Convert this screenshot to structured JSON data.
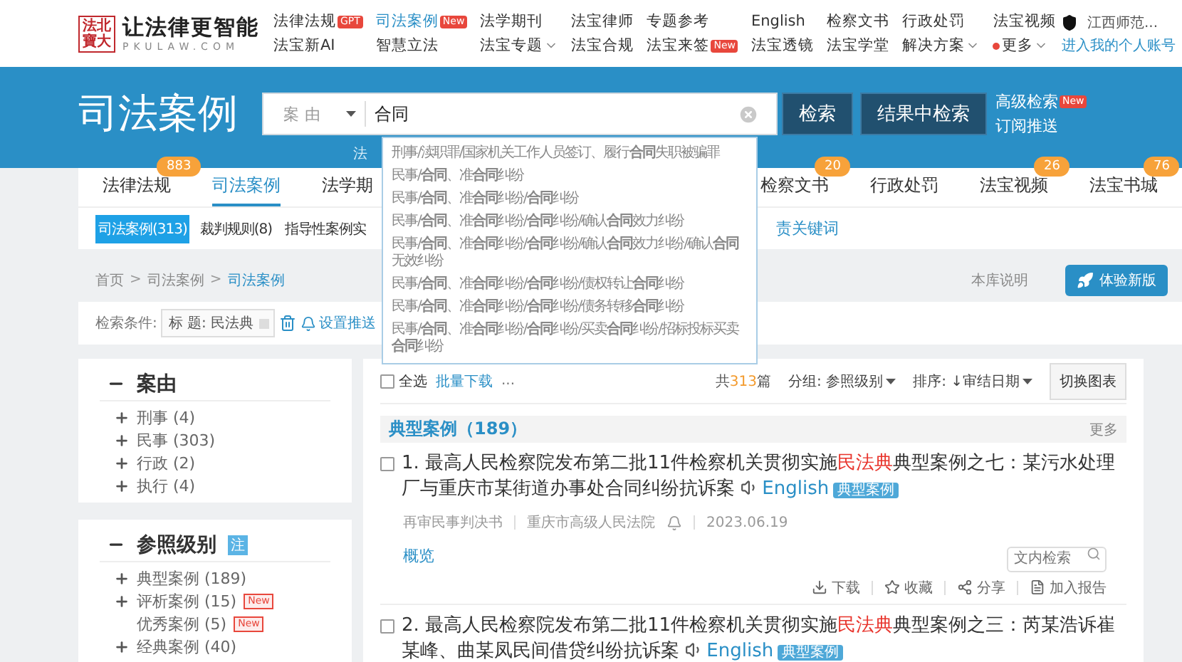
{
  "header": {
    "logo": {
      "seal": "法北寶大",
      "slogan": "让法律更智能",
      "domain": "PKULAW.COM"
    },
    "nav": [
      {
        "label": "法律法规",
        "selected": false,
        "badge": "GPT",
        "has_menu": false
      },
      {
        "label": "法宝新AI",
        "selected": false,
        "has_menu": false
      },
      {
        "label": "司法案例",
        "selected": true,
        "badge": "New",
        "has_menu": false
      },
      {
        "label": "智慧立法",
        "selected": false,
        "has_menu": false
      },
      {
        "label": "法学期刊",
        "selected": false,
        "has_menu": false
      },
      {
        "label": "法宝专题",
        "selected": false,
        "has_menu": true
      },
      {
        "label": "法宝律师",
        "selected": false,
        "has_menu": false
      },
      {
        "label": "法宝合规",
        "selected": false,
        "has_menu": false
      },
      {
        "label": "专题参考",
        "selected": false,
        "has_menu": false
      },
      {
        "label": "法宝来签",
        "selected": false,
        "badge": "New",
        "has_menu": false
      },
      {
        "label": "English",
        "selected": false,
        "has_menu": false
      },
      {
        "label": "法宝透镜",
        "selected": false,
        "has_menu": false
      },
      {
        "label": "检察文书",
        "selected": false,
        "has_menu": false
      },
      {
        "label": "法宝学堂",
        "selected": false,
        "has_menu": false
      },
      {
        "label": "行政处罚",
        "selected": false,
        "has_menu": false
      },
      {
        "label": "解决方案",
        "selected": false,
        "has_menu": true
      },
      {
        "label": "法宝视频",
        "selected": false,
        "has_menu": false
      },
      {
        "label": "更多",
        "selected": false,
        "has_menu": true,
        "notice": true
      }
    ],
    "account": {
      "name": "江西师范...",
      "link": "进入我的个人账号"
    }
  },
  "banner": {
    "title": "司法案例",
    "search": {
      "scope": "案由",
      "value": "合同"
    },
    "buttons": [
      "检索",
      "结果中检索"
    ],
    "links": [
      {
        "label": "高级检索",
        "badge": "New"
      },
      {
        "label": "订阅推送"
      }
    ],
    "hint": "法"
  },
  "suggestions": [
    "刑事/渎职罪/国家机关工作人员签订、履行**合同**失职被骗罪",
    "民事/**合同**、准**合同**纠纷",
    "民事/**合同**、准**合同**纠纷/**合同**纠纷",
    "民事/**合同**、准**合同**纠纷/**合同**纠纷/确认**合同**效力纠纷",
    "民事/**合同**、准**合同**纠纷/**合同**纠纷/确认**合同**效力纠纷/确认**合同**无效纠纷",
    "民事/**合同**、准**合同**纠纷/**合同**纠纷/债权转让**合同**纠纷",
    "民事/**合同**、准**合同**纠纷/**合同**纠纷/债务转移**合同**纠纷",
    "民事/**合同**、准**合同**纠纷/**合同**纠纷/买卖**合同**纠纷/招标投标买卖**合同**纠纷"
  ],
  "tabs": [
    {
      "label": "法律法规",
      "count": "883",
      "selected": false
    },
    {
      "label": "司法案例",
      "selected": true
    },
    {
      "label": "法学期",
      "selected": false
    },
    {
      "label": "检察文书",
      "count": "20",
      "selected": false
    },
    {
      "label": "行政处罚",
      "selected": false
    },
    {
      "label": "法宝视频",
      "count": "26",
      "selected": false
    },
    {
      "label": "法宝书城",
      "count": "76",
      "selected": false
    }
  ],
  "subtabs": [
    {
      "label": "司法案例(313)",
      "selected": true
    },
    {
      "label": "裁判规则(8)",
      "selected": false
    },
    {
      "label": "指导性案例实",
      "selected": false
    }
  ],
  "subtab_link": "责关键词",
  "breadcrumb": {
    "items": [
      "首页",
      "司法案例",
      "司法案例"
    ],
    "separator": ">"
  },
  "library_note": "本库说明",
  "new_version_button": "体验新版",
  "filter": {
    "label": "检索条件:",
    "chip": "标 题: 民法典",
    "push_link": "设置推送"
  },
  "sidebar": [
    {
      "title": "案由",
      "expanded": true,
      "items": [
        {
          "label": "刑事 (4)",
          "expandable": true
        },
        {
          "label": "民事 (303)",
          "expandable": true
        },
        {
          "label": "行政 (2)",
          "expandable": true
        },
        {
          "label": "执行 (4)",
          "expandable": true
        }
      ]
    },
    {
      "title": "参照级别",
      "badge": "注",
      "expanded": true,
      "items": [
        {
          "label": "典型案例 (189)",
          "expandable": true
        },
        {
          "label": "评析案例 (15)",
          "expandable": true,
          "badge": "New"
        },
        {
          "label": "优秀案例 (5)",
          "expandable": false,
          "badge": "New"
        },
        {
          "label": "经典案例 (40)",
          "expandable": true
        }
      ]
    }
  ],
  "toolbar": {
    "select_all": {
      "label": "全选",
      "checked": false
    },
    "batch_download": "批量下载",
    "more": "...",
    "total": {
      "prefix": "共",
      "count": "313",
      "suffix": "篇"
    },
    "group": "分组: 参照级别",
    "sort": "排序: ↓审结日期",
    "switch_button": "切换图表"
  },
  "section": {
    "title": "典型案例（189）",
    "more": "更多"
  },
  "results": [
    {
      "checked": false,
      "title_parts": [
        {
          "text": "1. 最高人民检察院发布第二批11件检察机关贯彻实施",
          "highlight": false
        },
        {
          "text": "民法典",
          "highlight": true
        },
        {
          "text": "典型案例之七：某污水处理厂与重庆市某街道办事处合同纠纷抗诉案",
          "highlight": false
        }
      ],
      "language_link": "English",
      "tag": "典型案例",
      "meta": [
        "再审民事判决书",
        "重庆市高级人民法院",
        "2023.06.19"
      ],
      "overview": "概览",
      "search_placeholder": "文内检索",
      "actions": [
        "下载",
        "收藏",
        "分享",
        "加入报告"
      ]
    },
    {
      "checked": false,
      "title_parts": [
        {
          "text": "2. 最高人民检察院发布第二批11件检察机关贯彻实施",
          "highlight": false
        },
        {
          "text": "民法典",
          "highlight": true
        },
        {
          "text": "典型案例之三：芮某浩诉崔某峰、曲某凤民间借贷纠纷抗诉案",
          "highlight": false
        }
      ],
      "language_link": "English",
      "tag": "典型案例"
    }
  ]
}
